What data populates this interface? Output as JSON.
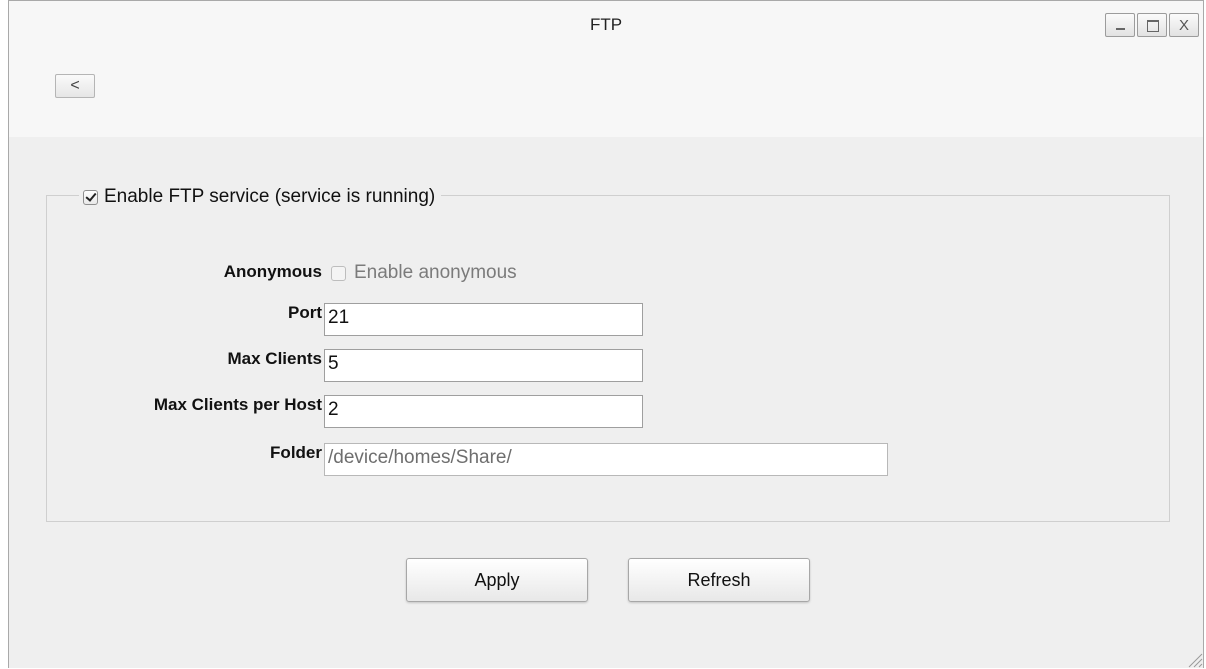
{
  "window": {
    "title": "FTP",
    "controls": {
      "minimize_icon": "minimize-icon",
      "maximize_icon": "maximize-icon",
      "close_label": "X"
    }
  },
  "toolbar": {
    "back_label": "<"
  },
  "service": {
    "enable_label": "Enable FTP service (service is running)",
    "enabled": true
  },
  "form": {
    "anonymous": {
      "label": "Anonymous",
      "checkbox_label": "Enable anonymous",
      "checked": false,
      "disabled": true
    },
    "port": {
      "label": "Port",
      "value": "21"
    },
    "max_clients": {
      "label": "Max Clients",
      "value": "5"
    },
    "max_clients_per_host": {
      "label": "Max Clients per Host",
      "value": "2"
    },
    "folder": {
      "label": "Folder",
      "value": "/device/homes/Share/"
    }
  },
  "actions": {
    "apply_label": "Apply",
    "refresh_label": "Refresh"
  },
  "colors": {
    "window_background": "#efefef",
    "titlebar_background": "#f7f7f7",
    "disabled_text": "#7b7b7b"
  }
}
